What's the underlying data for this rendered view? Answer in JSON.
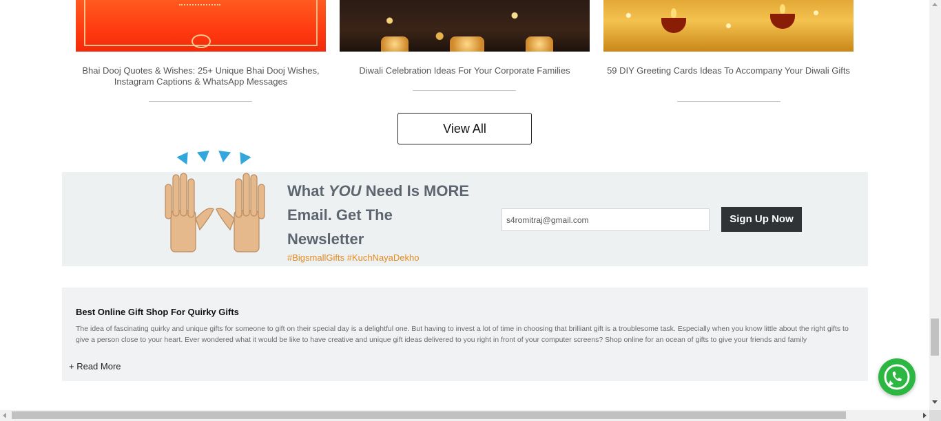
{
  "blog_cards": [
    {
      "title": "Bhai Dooj Quotes & Wishes: 25+ Unique Bhai Dooj Wishes, Instagram Captions & WhatsApp Messages"
    },
    {
      "title": "Diwali Celebration Ideas For Your Corporate Families"
    },
    {
      "title": "59 DIY Greeting Cards Ideas To Accompany Your Diwali Gifts"
    }
  ],
  "view_all_label": "View All",
  "newsletter": {
    "heading_pre": "What ",
    "heading_em": "YOU",
    "heading_post": " Need Is MORE Email. Get The Newsletter",
    "tags": "#BigsmallGifts #KuchNayaDekho",
    "email_value": "s4romitraj@gmail.com",
    "signup_label": "Sign Up Now"
  },
  "seo": {
    "title": "Best Online Gift Shop For Quirky Gifts",
    "text": "The idea of fascinating quirky and unique gifts for someone to gift on their special day is a delightful one. But having to invest a lot of time in choosing that brilliant gift is a troublesome task. Especially when you know little about the right gifts to give a person close to your heart. Ever wondered what it would be like to have creative and unique gift ideas delivered to you right in front of your computer screens? Shop online for an ocean of gifts to give your friends and family",
    "read_more": "+ Read More"
  },
  "colors": {
    "accent_orange": "#e48a1d",
    "signup_bg": "#2f3336",
    "whatsapp_green": "#2bb741",
    "newsletter_bg": "#eef1f1"
  },
  "icons": {
    "raised_hands": "raising-hands-icon",
    "whatsapp": "whatsapp-icon"
  }
}
